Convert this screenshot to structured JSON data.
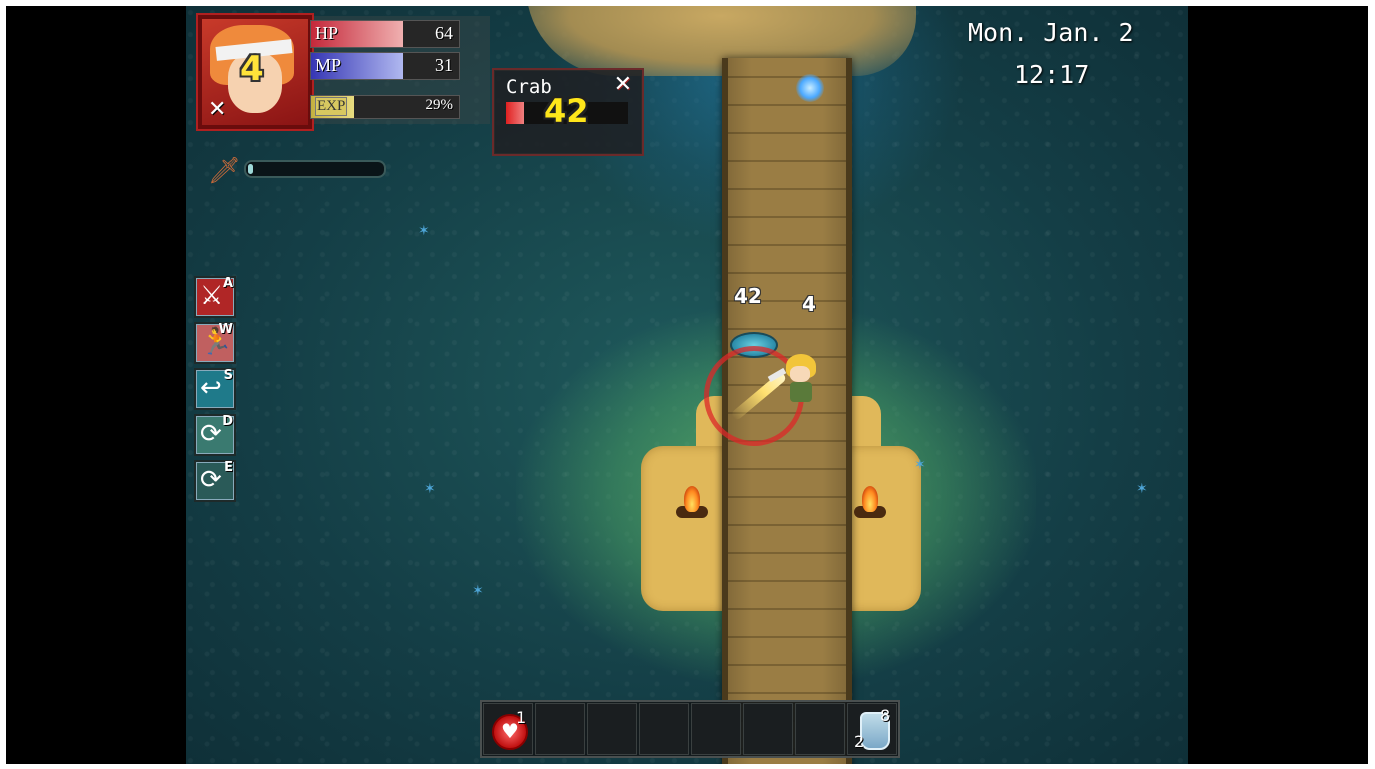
{
  "hud": {
    "portrait": {
      "level": "4",
      "icon": "crossed-swords-icon"
    },
    "hp": {
      "label": "HP",
      "value": "64",
      "fill": 0.62
    },
    "mp": {
      "label": "MP",
      "value": "31",
      "fill": 0.62
    },
    "exp": {
      "label": "EXP",
      "value": "29%",
      "fill": 0.29
    },
    "charge_fill": 0.04
  },
  "enemy": {
    "name": "Crab",
    "level": "42",
    "hp_fill": 0.15,
    "close_icon": "crossed-swords-icon"
  },
  "clock": {
    "date": "Mon. Jan. 2",
    "time": "12:17"
  },
  "skills": [
    {
      "key": "A",
      "icon": "sword-icon",
      "color": "#b02626"
    },
    {
      "key": "W",
      "icon": "running-man-icon",
      "color": "#c06060"
    },
    {
      "key": "S",
      "icon": "return-arrow-icon",
      "color": "#1f7a8a"
    },
    {
      "key": "D",
      "icon": "cycle-icon",
      "color": "#3a7a70"
    },
    {
      "key": "E",
      "icon": "cycle-icon",
      "color": "#2a5a58"
    }
  ],
  "floating_text": {
    "enemy_level": "42",
    "player_level": "4"
  },
  "hotbar": {
    "slots": [
      {
        "icon": "heart-potion-icon",
        "count": "1"
      },
      {
        "icon": "",
        "count": ""
      },
      {
        "icon": "",
        "count": ""
      },
      {
        "icon": "",
        "count": ""
      },
      {
        "icon": "",
        "count": ""
      },
      {
        "icon": "",
        "count": ""
      },
      {
        "icon": "",
        "count": ""
      },
      {
        "icon": "bottle-icon",
        "count": "8",
        "sub": "2"
      }
    ]
  }
}
